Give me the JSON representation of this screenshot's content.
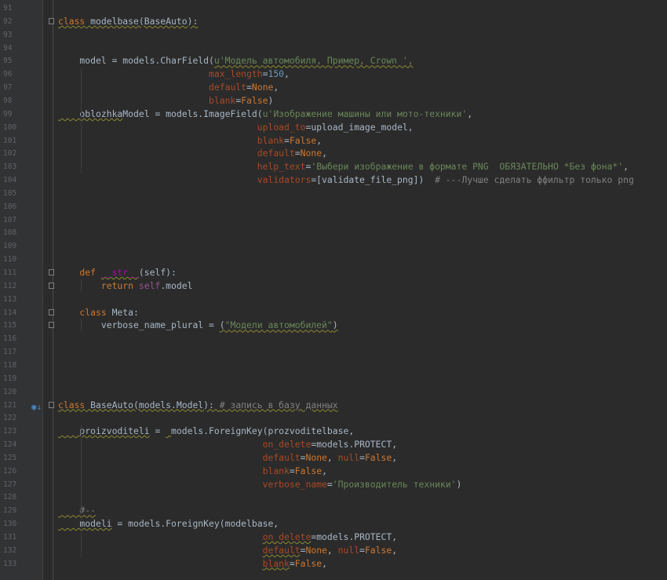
{
  "editor": {
    "lines": [
      {
        "n": "91",
        "t": []
      },
      {
        "n": "92",
        "fold": true,
        "t": [
          [
            "kw wavy",
            "class"
          ],
          [
            "wavy",
            " modelbase(BaseAuto):"
          ]
        ]
      },
      {
        "n": "93",
        "t": []
      },
      {
        "n": "94",
        "t": []
      },
      {
        "n": "95",
        "t": [
          [
            "",
            "    model = models.CharField("
          ],
          [
            "str wavy",
            "u'Модель автомобиля, Пример, Crown ',"
          ]
        ]
      },
      {
        "n": "96",
        "t": [
          [
            "",
            "                            "
          ],
          [
            "param",
            "max_length"
          ],
          [
            "",
            "="
          ],
          [
            "num",
            "150"
          ],
          [
            "",
            ","
          ]
        ]
      },
      {
        "n": "97",
        "t": [
          [
            "",
            "                            "
          ],
          [
            "param",
            "default"
          ],
          [
            "",
            "="
          ],
          [
            "kw",
            "None"
          ],
          [
            "",
            ","
          ]
        ]
      },
      {
        "n": "98",
        "t": [
          [
            "",
            "                            "
          ],
          [
            "param",
            "blank"
          ],
          [
            "",
            "="
          ],
          [
            "kw",
            "False"
          ],
          [
            "",
            ")"
          ]
        ]
      },
      {
        "n": "99",
        "t": [
          [
            "wavy",
            "    oblozhka"
          ],
          [
            "",
            "Model = models.ImageField("
          ],
          [
            "str",
            "u'Изображение машины или мото-техники'"
          ],
          [
            "",
            ","
          ]
        ]
      },
      {
        "n": "100",
        "t": [
          [
            "",
            "                                     "
          ],
          [
            "param",
            "upload_to"
          ],
          [
            "",
            "=upload_image_model,"
          ]
        ]
      },
      {
        "n": "101",
        "t": [
          [
            "",
            "                                     "
          ],
          [
            "param",
            "blank"
          ],
          [
            "",
            "="
          ],
          [
            "kw",
            "False"
          ],
          [
            "",
            ","
          ]
        ]
      },
      {
        "n": "102",
        "t": [
          [
            "",
            "                                     "
          ],
          [
            "param",
            "default"
          ],
          [
            "",
            "="
          ],
          [
            "kw",
            "None"
          ],
          [
            "",
            ","
          ]
        ]
      },
      {
        "n": "103",
        "t": [
          [
            "",
            "                                     "
          ],
          [
            "param",
            "help_text"
          ],
          [
            "",
            "="
          ],
          [
            "str",
            "'Выбери изображение в формате PNG  ОБЯЗАТЕЛЬНО *Без фона*'"
          ],
          [
            "",
            ","
          ]
        ]
      },
      {
        "n": "104",
        "t": [
          [
            "",
            "                                     "
          ],
          [
            "param",
            "validators"
          ],
          [
            "",
            "=[validate_file_png])  "
          ],
          [
            "cmt",
            "# ---Лучше сделать ффильтр только png"
          ]
        ]
      },
      {
        "n": "105",
        "t": []
      },
      {
        "n": "106",
        "t": []
      },
      {
        "n": "107",
        "t": []
      },
      {
        "n": "108",
        "t": []
      },
      {
        "n": "109",
        "t": []
      },
      {
        "n": "110",
        "t": []
      },
      {
        "n": "111",
        "fold": true,
        "t": [
          [
            "kw",
            "    def "
          ],
          [
            "magic wavy",
            "__str__"
          ],
          [
            "",
            "(self):"
          ]
        ]
      },
      {
        "n": "112",
        "fold": true,
        "t": [
          [
            "kw",
            "        return "
          ],
          [
            "self",
            "self"
          ],
          [
            "",
            ".model"
          ]
        ]
      },
      {
        "n": "113",
        "t": []
      },
      {
        "n": "114",
        "fold": true,
        "t": [
          [
            "kw",
            "    class "
          ],
          [
            "",
            "Meta:"
          ]
        ]
      },
      {
        "n": "115",
        "fold": true,
        "t": [
          [
            "",
            "        verbose_name_plural = "
          ],
          [
            "wavy",
            "("
          ],
          [
            "str wavy",
            "\"Модели автомобилей\""
          ],
          [
            "wavy",
            ")"
          ]
        ]
      },
      {
        "n": "116",
        "t": []
      },
      {
        "n": "117",
        "t": []
      },
      {
        "n": "118",
        "t": []
      },
      {
        "n": "119",
        "t": []
      },
      {
        "n": "120",
        "t": []
      },
      {
        "n": "121",
        "fold": true,
        "bookmark": true,
        "t": [
          [
            "kw wavy",
            "class"
          ],
          [
            "wavy",
            " BaseAuto(models.Model): "
          ],
          [
            "cmt wavy",
            "# запись в базу данных"
          ]
        ]
      },
      {
        "n": "122",
        "t": []
      },
      {
        "n": "123",
        "t": [
          [
            "wavy",
            "    proizvoditeli"
          ],
          [
            "",
            " = "
          ],
          [
            "wavy",
            " "
          ],
          [
            "",
            "models.ForeignKey(prozvoditelbase,"
          ]
        ]
      },
      {
        "n": "124",
        "t": [
          [
            "",
            "                                      "
          ],
          [
            "param",
            "on_delete"
          ],
          [
            "",
            "=models.PROTECT,"
          ]
        ]
      },
      {
        "n": "125",
        "t": [
          [
            "",
            "                                      "
          ],
          [
            "param",
            "default"
          ],
          [
            "",
            "="
          ],
          [
            "kw",
            "None"
          ],
          [
            "",
            ", "
          ],
          [
            "param",
            "null"
          ],
          [
            "",
            "="
          ],
          [
            "kw",
            "False"
          ],
          [
            "",
            ","
          ]
        ]
      },
      {
        "n": "126",
        "t": [
          [
            "",
            "                                      "
          ],
          [
            "param",
            "blank"
          ],
          [
            "",
            "="
          ],
          [
            "kw",
            "False"
          ],
          [
            "",
            ","
          ]
        ]
      },
      {
        "n": "127",
        "t": [
          [
            "",
            "                                      "
          ],
          [
            "param",
            "verbose_name"
          ],
          [
            "",
            "="
          ],
          [
            "str",
            "'Производитель техники'"
          ],
          [
            "",
            ")"
          ]
        ]
      },
      {
        "n": "128",
        "t": []
      },
      {
        "n": "129",
        "t": [
          [
            "cmt wavy",
            "    #--"
          ]
        ]
      },
      {
        "n": "130",
        "t": [
          [
            "wavy",
            "    modeli"
          ],
          [
            "",
            " = models.ForeignKey(modelbase,"
          ]
        ]
      },
      {
        "n": "131",
        "t": [
          [
            "",
            "                                      "
          ],
          [
            "param wavy",
            "on_delete"
          ],
          [
            "",
            "=models.PROTECT,"
          ]
        ]
      },
      {
        "n": "132",
        "t": [
          [
            "",
            "                                      "
          ],
          [
            "param wavy",
            "default"
          ],
          [
            "",
            "="
          ],
          [
            "kw",
            "None"
          ],
          [
            "",
            ", "
          ],
          [
            "param",
            "null"
          ],
          [
            "",
            "="
          ],
          [
            "kw",
            "False"
          ],
          [
            "",
            ","
          ]
        ]
      },
      {
        "n": "133",
        "t": [
          [
            "",
            "                                      "
          ],
          [
            "param wavy",
            "blank"
          ],
          [
            "",
            "="
          ],
          [
            "kw",
            "False"
          ],
          [
            "",
            ","
          ]
        ]
      }
    ]
  }
}
